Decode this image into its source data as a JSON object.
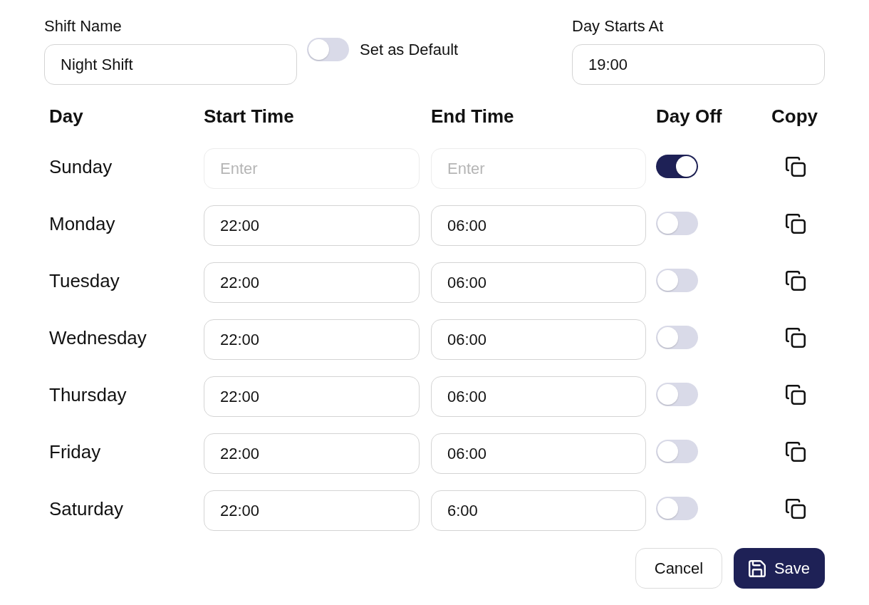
{
  "shift_name": {
    "label": "Shift Name",
    "value": "Night Shift"
  },
  "set_as_default": {
    "label": "Set as Default",
    "on": false
  },
  "day_starts_at": {
    "label": "Day Starts At",
    "value": "19:00"
  },
  "table": {
    "columns": [
      "Day",
      "Start Time",
      "End Time",
      "Day Off",
      "Copy"
    ],
    "rows": [
      {
        "day": "Sunday",
        "start_time": {
          "placeholder": "Enter"
        },
        "end_time": {
          "placeholder": "Enter"
        },
        "day_off": true
      },
      {
        "day": "Monday",
        "start_time": {
          "value": "22:00"
        },
        "end_time": {
          "value": "06:00"
        },
        "day_off": false
      },
      {
        "day": "Tuesday",
        "start_time": {
          "value": "22:00"
        },
        "end_time": {
          "value": "06:00"
        },
        "day_off": false
      },
      {
        "day": "Wednesday",
        "start_time": {
          "value": "22:00"
        },
        "end_time": {
          "value": "06:00"
        },
        "day_off": false
      },
      {
        "day": "Thursday",
        "start_time": {
          "value": "22:00"
        },
        "end_time": {
          "value": "06:00"
        },
        "day_off": false
      },
      {
        "day": "Friday",
        "start_time": {
          "value": "22:00"
        },
        "end_time": {
          "value": "06:00"
        },
        "day_off": false
      },
      {
        "day": "Saturday",
        "start_time": {
          "value": "22:00"
        },
        "end_time": {
          "value": "6:00"
        },
        "day_off": false
      }
    ]
  },
  "buttons": [
    {
      "label": "Cancel",
      "kind": "secondary"
    },
    {
      "label": "Save",
      "kind": "primary"
    }
  ]
}
